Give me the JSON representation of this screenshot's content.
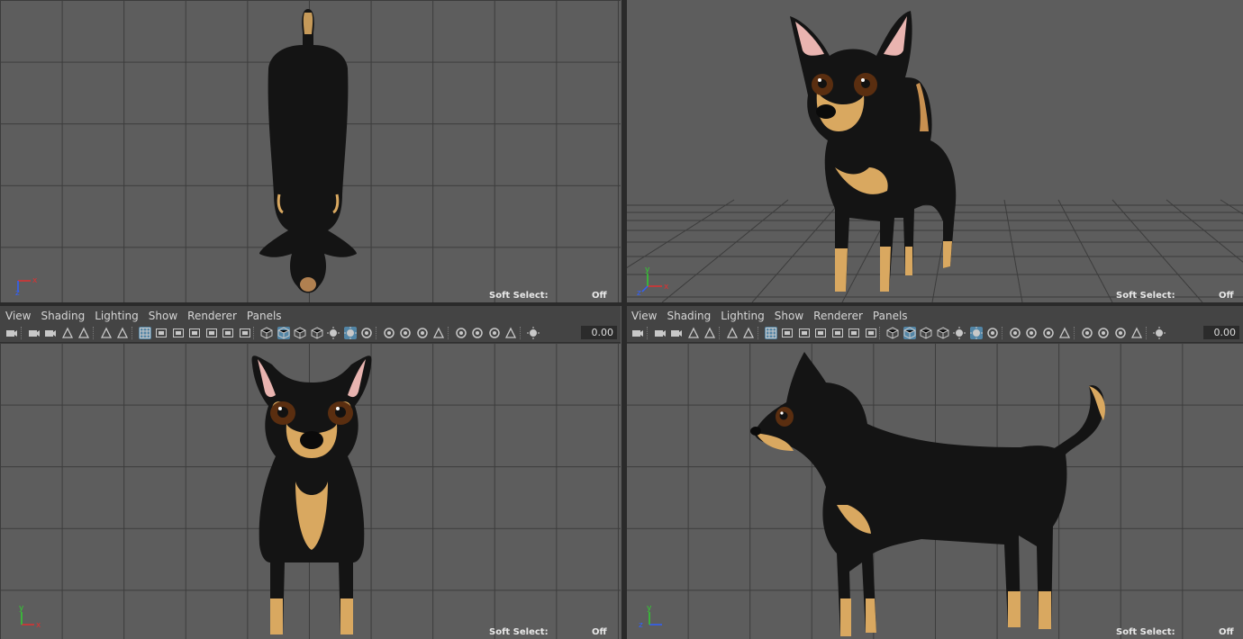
{
  "menus": [
    "View",
    "Shading",
    "Lighting",
    "Show",
    "Renderer",
    "Panels"
  ],
  "soft_select": {
    "label": "Soft Select:",
    "value": "Off"
  },
  "value_field": "0.00",
  "axis_labels": {
    "x": "x",
    "y": "y",
    "z": "z"
  },
  "viewports": [
    {
      "id": "top-view",
      "axes": [
        "x",
        "z"
      ]
    },
    {
      "id": "persp-view",
      "axes": [
        "x",
        "y",
        "z"
      ]
    },
    {
      "id": "front-view",
      "axes": [
        "x",
        "y"
      ]
    },
    {
      "id": "side-view",
      "axes": [
        "y",
        "z"
      ]
    }
  ],
  "colors": {
    "viewport_bg": "#5d5d5d",
    "grid_line": "#3c3c3c",
    "toolbar_bg": "#444444",
    "active_tool": "#5285a6",
    "axis_x": "#e03030",
    "axis_y": "#30d030",
    "axis_z": "#3060ff",
    "dog_black": "#141414",
    "dog_tan": "#d9a860"
  },
  "toolbar_icons": [
    "camera-select-icon",
    "camera-lock-icon",
    "camera-attributes-icon",
    "bookmarks-icon",
    "image-plane-icon",
    "2d-pan-zoom-icon",
    "grease-pencil-icon",
    "grid-icon",
    "film-gate-icon",
    "resolution-gate-icon",
    "gate-mask-icon",
    "field-chart-icon",
    "safe-action-icon",
    "safe-title-icon",
    "wireframe-icon",
    "smooth-shade-icon",
    "default-material-icon",
    "textured-icon",
    "shadows-icon",
    "use-all-lights-icon",
    "screen-space-ao-icon",
    "motion-blur-icon",
    "multisample-aa-icon",
    "depth-of-field-icon",
    "isolate-select-icon",
    "xray-icon",
    "xray-active-components-icon",
    "xray-joints-icon",
    "backface-culling-icon",
    "exposure-icon"
  ]
}
